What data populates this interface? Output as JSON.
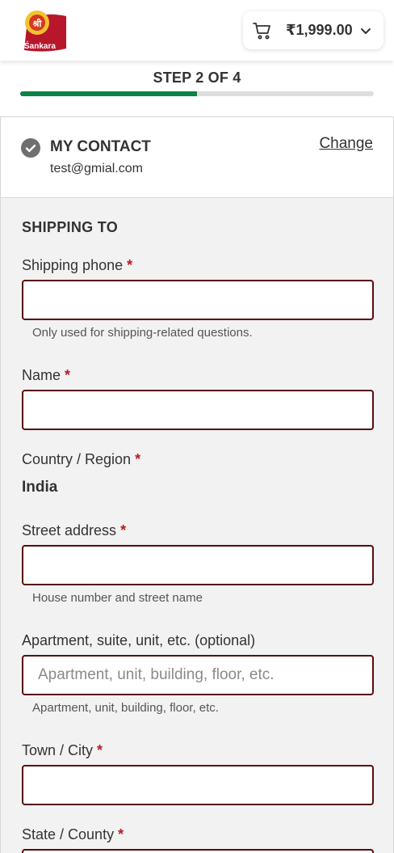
{
  "header": {
    "logo_text": "Sankara",
    "cart_total": "₹1,999.00"
  },
  "progress": {
    "step_label": "STEP 2 OF 4",
    "fraction": 0.5
  },
  "contact": {
    "title": "MY CONTACT",
    "email": "test@gmial.com",
    "change_label": "Change"
  },
  "shipping": {
    "title": "SHIPPING TO",
    "required_mark": "*",
    "phone": {
      "label": "Shipping phone",
      "value": "",
      "help": "Only used for shipping-related questions."
    },
    "name": {
      "label": "Name",
      "value": ""
    },
    "country": {
      "label": "Country / Region",
      "value": "India"
    },
    "street": {
      "label": "Street address",
      "value": "",
      "help": "House number and street name"
    },
    "apartment": {
      "label": "Apartment, suite, unit, etc. (optional)",
      "value": "",
      "placeholder": "Apartment, unit, building, floor, etc.",
      "help": "Apartment, unit, building, floor, etc."
    },
    "city": {
      "label": "Town / City",
      "value": ""
    },
    "state": {
      "label": "State / County"
    }
  },
  "colors": {
    "progress_green": "#0c8148",
    "field_border": "#5a0c0c",
    "required_red": "#b81c23",
    "logo_red": "#b8162a",
    "logo_yellow": "#f2c230"
  },
  "icons": {
    "cart": "cart-icon",
    "chevron": "chevron-down-icon",
    "check": "check-circle-icon"
  }
}
